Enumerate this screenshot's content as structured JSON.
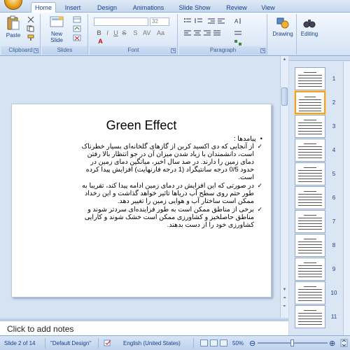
{
  "ribbon": {
    "tabs": [
      {
        "label": "Home"
      },
      {
        "label": "Insert"
      },
      {
        "label": "Design"
      },
      {
        "label": "Animations"
      },
      {
        "label": "Slide Show"
      },
      {
        "label": "Review"
      },
      {
        "label": "View"
      }
    ],
    "groups": {
      "clipboard": {
        "label": "Clipboard",
        "paste_label": "Paste"
      },
      "slides": {
        "label": "Slides",
        "new_slide_label": "New Slide"
      },
      "font": {
        "label": "Font",
        "font_size": "32"
      },
      "paragraph": {
        "label": "Paragraph"
      },
      "drawing": {
        "label": "Drawing"
      },
      "editing": {
        "label": "Editing"
      }
    }
  },
  "slide": {
    "title": "Green Effect",
    "bullet_head": "پیامدها :",
    "paragraphs": [
      [
        "از آنجایی که دی اکسید کربن از گازهای گلخانه‌ای بسیار خطرناک",
        "است، دانشمندان با زیاد شدن میزان آن در جو انتظار بالا رفتن",
        "دمای زمین را دارند. در صد سال اخیر، میانگین دمای زمین در",
        "حدود 0/5 درجه سانتیگراد (1 درجه فارنهایت) افزایش پیدا کرده",
        "است."
      ],
      [
        "در صورتی که این افزایش در دمای زمین ادامه پیدا کند، تقریبا به",
        "طور حتم روی سطح آب دریاها تاثیر خواهد گذاشت و این رخداد",
        "ممکن است ساختار آب و هوایی زمین را تغییر دهد."
      ],
      [
        "برخی از مناطق ممکن است به طور فزاینده‌ای سردتر شوند و",
        "مناطق حاصلخیز و کشاورزی ممکن است خشک شوند و کارایی",
        "کشاورزی خود را از دست بدهند."
      ]
    ]
  },
  "notes": {
    "placeholder": "Click to add notes"
  },
  "thumbnails": [
    "1",
    "2",
    "3",
    "4",
    "5",
    "6",
    "7",
    "8",
    "9",
    "10",
    "11"
  ],
  "selected_thumbnail": "2",
  "status": {
    "slide_position": "Slide 2 of 14",
    "theme": "\"Default Design\"",
    "language": "English (United States)",
    "zoom": "50%"
  },
  "colors": {
    "ribbon_blue": "#15428b",
    "selection_orange": "#f0a030"
  }
}
